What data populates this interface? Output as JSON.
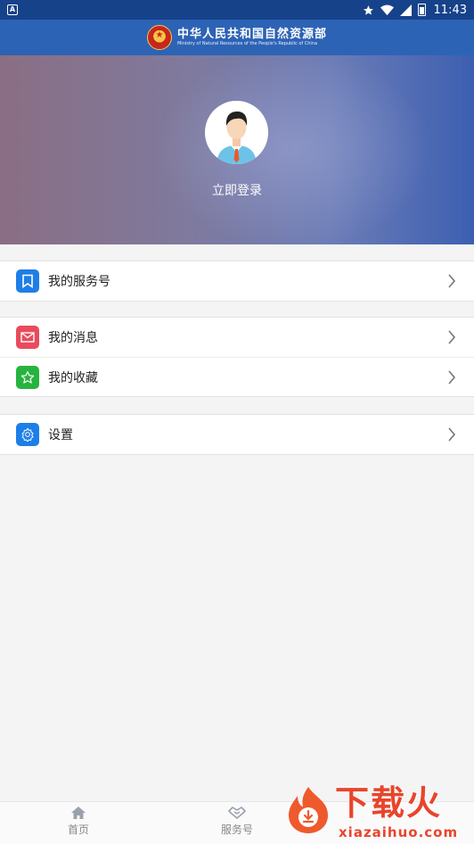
{
  "status_bar": {
    "time": "11:43",
    "notification_icon": "A"
  },
  "header": {
    "title_cn": "中华人民共和国自然资源部",
    "title_en": "Ministry of Natural Resources of the People's Republic of China"
  },
  "profile": {
    "login_label": "立即登录"
  },
  "menu": {
    "service": {
      "label": "我的服务号",
      "icon": "bookmark-icon",
      "color": "#1e7ee8"
    },
    "messages": {
      "label": "我的消息",
      "icon": "mail-icon",
      "color": "#e94b5d"
    },
    "favorites": {
      "label": "我的收藏",
      "icon": "star-icon",
      "color": "#27b33f"
    },
    "settings": {
      "label": "设置",
      "icon": "gear-icon",
      "color": "#1e7ee8"
    }
  },
  "bottom_nav": {
    "home": "首页",
    "service": "服务号"
  },
  "watermark": {
    "cn": "下载火",
    "en": "xiazaihuo.com"
  }
}
